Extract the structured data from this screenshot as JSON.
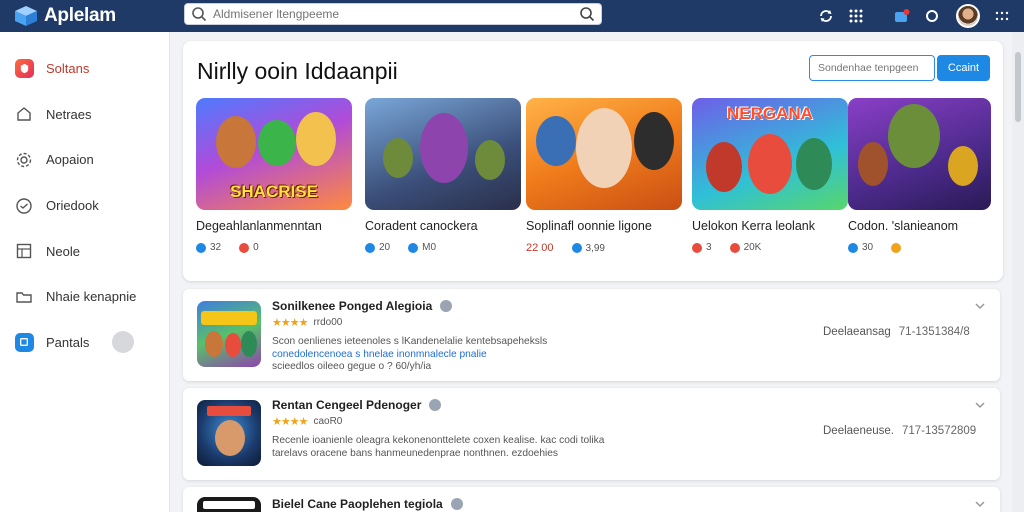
{
  "app": {
    "name": "Aplelam"
  },
  "search": {
    "placeholder": "Aldmisener ltengpeeme"
  },
  "sidebar": {
    "items": [
      {
        "label": "Soltans",
        "icon": "shield-app-icon"
      },
      {
        "label": "Netraes",
        "icon": "home-icon"
      },
      {
        "label": "Aopaion",
        "icon": "gear-icon"
      },
      {
        "label": "Oriedook",
        "icon": "circle-check-icon"
      },
      {
        "label": "Neole",
        "icon": "grid-icon"
      },
      {
        "label": "Nhaie kenapnie",
        "icon": "folder-icon"
      },
      {
        "label": "Pantals",
        "icon": "app-badge-icon"
      }
    ]
  },
  "featured": {
    "title": "Nirlly ooin Iddaanpii",
    "input_placeholder": "Sondenhae tenpgeen",
    "button_label": "Ccaint",
    "games": [
      {
        "title": "Degeahlanlanmenntan",
        "banner": "SHACRISE",
        "stat1": "32",
        "stat2": "0",
        "c1": "#1e88e5",
        "c2": "#e74c3c"
      },
      {
        "title": "Coradent canockera",
        "banner": "",
        "stat1": "20",
        "stat2": "M0",
        "c1": "#1e88e5",
        "c2": "#1e88e5"
      },
      {
        "title": "Soplinafl oonnie ligone",
        "banner": "",
        "stat1": "22 00",
        "stat2": "3,99",
        "c1": "#e74c3c",
        "c2": "#1e88e5"
      },
      {
        "title": "Uelokon Kerra leolank",
        "banner": "NERGANA",
        "stat1": "3",
        "stat2": "20K",
        "c1": "#e74c3c",
        "c2": "#e74c3c"
      },
      {
        "title": "Codon. 'slanieanom",
        "banner": "",
        "stat1": "30",
        "stat2": "",
        "c1": "#1e88e5",
        "c2": "#f0a21b"
      }
    ]
  },
  "list": [
    {
      "name": "Sonilkenee Ponged Alegioia",
      "rating_text": "rrdo00",
      "desc_line1": "Scon oenlienes ieteenoles s lKandenelalie kentebsapeheksls",
      "desc_line2": "conedolencenoea s hnelae inonmnalecle pnalie",
      "desc_line3": "scieedlos oileeo gegue o ? 60/yh/ia",
      "meta_label": "Deelaeansag",
      "meta_num": "71-1351384/8"
    },
    {
      "name": "Rentan Cengeel Pdenoger",
      "rating_text": "caoR0",
      "desc_line1": "Recenle ioanienle oleagra kekonenonttelete coxen kealise. kac codi tolika",
      "desc_line2": "tarelavs oracene bans hanmeunedenprae nonthnen. ezdoehies",
      "desc_line3": "",
      "meta_label": "Deelaeneuse.",
      "meta_num": "717-13572809"
    },
    {
      "name": "Bielel Cane Paoplehen tegiola",
      "rating_text": "",
      "desc_line1": "",
      "desc_line2": "",
      "desc_line3": "",
      "meta_label": "",
      "meta_num": ""
    }
  ]
}
